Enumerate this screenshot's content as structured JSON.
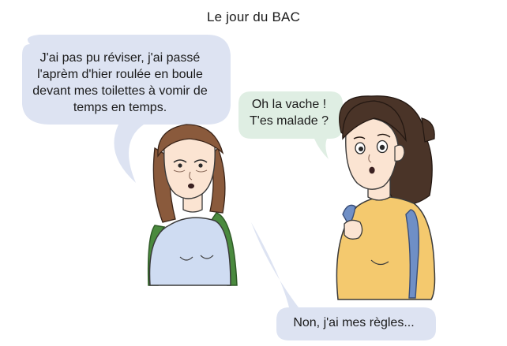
{
  "title": "Le jour du BAC",
  "bubbles": {
    "left_girl": "J'ai pas pu réviser, j'ai passé l'aprèm d'hier roulée en boule devant mes toilettes à vomir de temps en temps.",
    "right_girl": "Oh la vache ! T'es malade ?",
    "reply": "Non, j'ai mes règles..."
  },
  "colors": {
    "bubble_blue": "#dde3f2",
    "bubble_green": "#dfeee3",
    "shirt_blue": "#cfdcf2",
    "shirt_yellow": "#f4c96e",
    "backpack_green": "#4a8a3e",
    "backpack_blue": "#6f8fc6",
    "hair_left": "#8a5a3c",
    "hair_right": "#4a3428",
    "skin": "#fbe4d2"
  }
}
